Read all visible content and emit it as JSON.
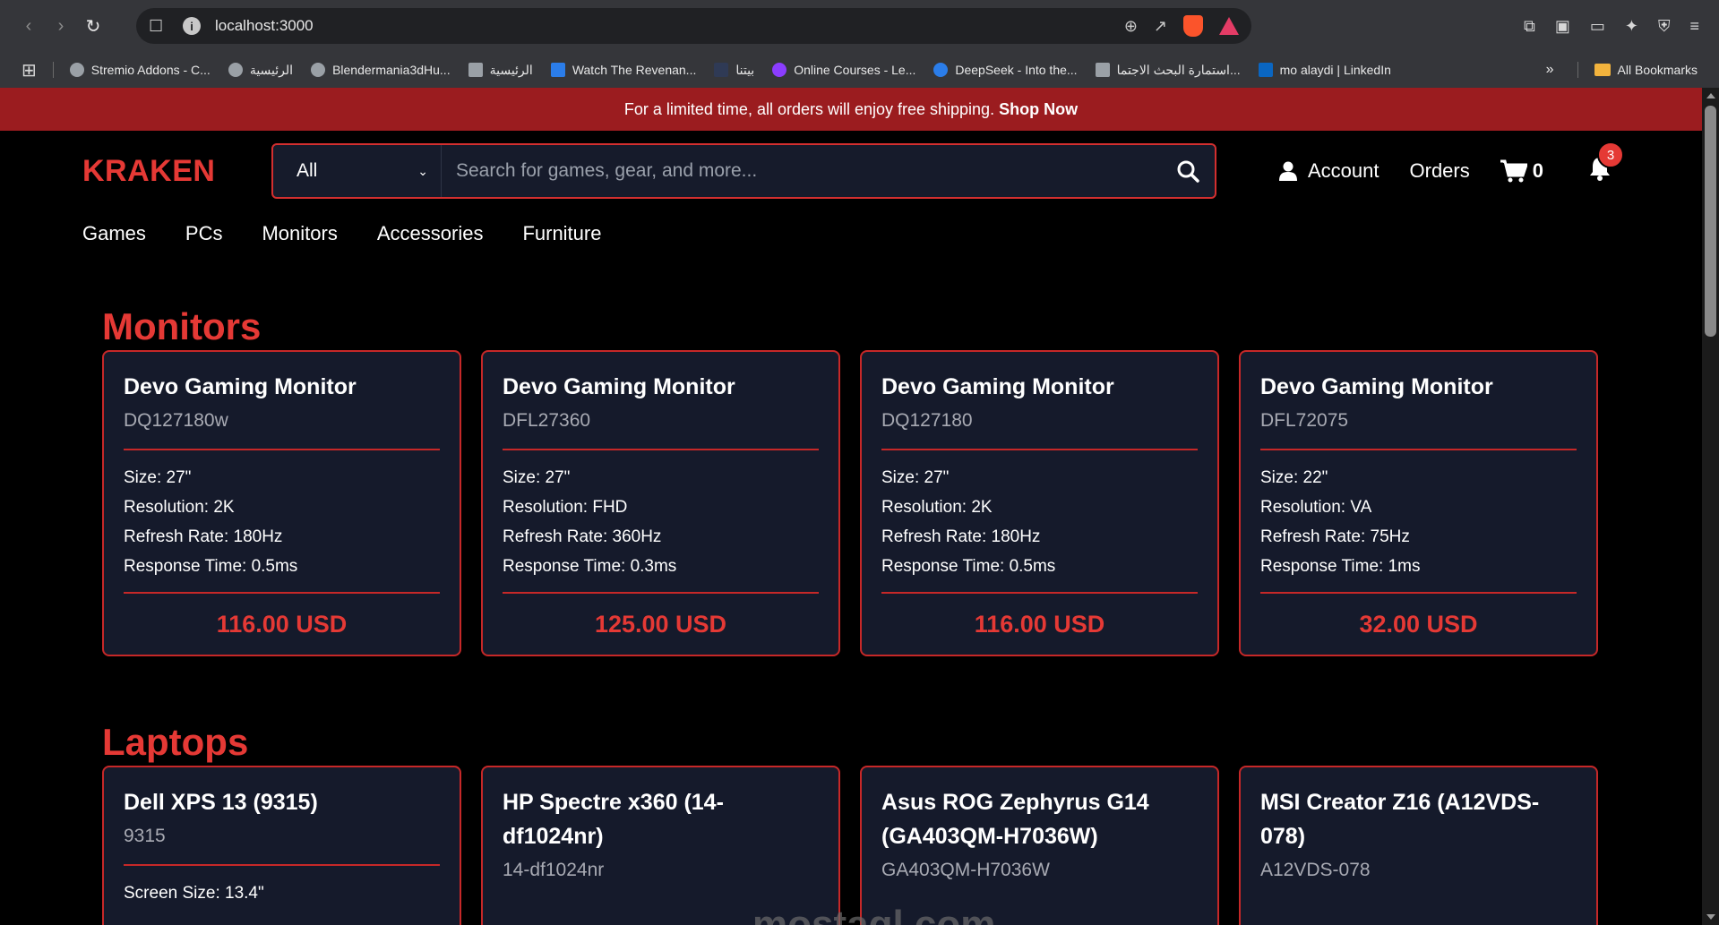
{
  "browser": {
    "url": "localhost:3000",
    "bookmarks": [
      {
        "label": "Stremio Addons - C..."
      },
      {
        "label": "الرئيسية"
      },
      {
        "label": "Blendermania3dHu..."
      },
      {
        "label": "الرئيسية"
      },
      {
        "label": "Watch The Revenan..."
      },
      {
        "label": "بيتنا"
      },
      {
        "label": "Online Courses - Le..."
      },
      {
        "label": "DeepSeek - Into the..."
      },
      {
        "label": "استمارة البحث الاجتما..."
      },
      {
        "label": "mo alaydi | LinkedIn"
      }
    ],
    "more_label": "»",
    "all_bookmarks": "All Bookmarks"
  },
  "promo": {
    "text": "For a limited time, all orders will enjoy free shipping.",
    "link": "Shop Now"
  },
  "header": {
    "logo": "KRAKEN",
    "search_category": "All",
    "search_placeholder": "Search for games, gear, and more...",
    "account": "Account",
    "orders": "Orders",
    "cart_count": "0",
    "notif_count": "3"
  },
  "nav": [
    "Games",
    "PCs",
    "Monitors",
    "Accessories",
    "Furniture"
  ],
  "monitors": {
    "title": "Monitors",
    "items": [
      {
        "name": "Devo Gaming Monitor",
        "model": "DQ127180w",
        "specs": [
          "Size: 27\"",
          "Resolution: 2K",
          "Refresh Rate: 180Hz",
          "Response Time: 0.5ms"
        ],
        "price": "116.00 USD"
      },
      {
        "name": "Devo Gaming Monitor",
        "model": "DFL27360",
        "specs": [
          "Size: 27\"",
          "Resolution: FHD",
          "Refresh Rate: 360Hz",
          "Response Time: 0.3ms"
        ],
        "price": "125.00 USD"
      },
      {
        "name": "Devo Gaming Monitor",
        "model": "DQ127180",
        "specs": [
          "Size: 27\"",
          "Resolution: 2K",
          "Refresh Rate: 180Hz",
          "Response Time: 0.5ms"
        ],
        "price": "116.00 USD"
      },
      {
        "name": "Devo Gaming Monitor",
        "model": "DFL72075",
        "specs": [
          "Size: 22\"",
          "Resolution: VA",
          "Refresh Rate: 75Hz",
          "Response Time: 1ms"
        ],
        "price": "32.00 USD"
      }
    ]
  },
  "laptops": {
    "title": "Laptops",
    "items": [
      {
        "name": "Dell XPS 13 (9315)",
        "model": "9315",
        "specs": [
          "Screen Size: 13.4\""
        ]
      },
      {
        "name": "HP Spectre x360 (14-df1024nr)",
        "model": "14-df1024nr",
        "specs": []
      },
      {
        "name": "Asus ROG Zephyrus G14 (GA403QM-H7036W)",
        "model": "GA403QM-H7036W",
        "specs": []
      },
      {
        "name": "MSI Creator Z16 (A12VDS-078)",
        "model": "A12VDS-078",
        "specs": []
      }
    ]
  },
  "watermark": "mostaql.com"
}
